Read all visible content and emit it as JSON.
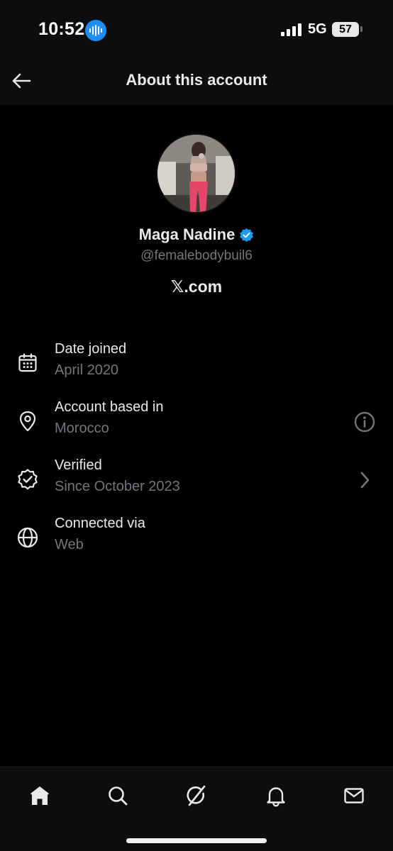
{
  "status_bar": {
    "time": "10:52",
    "network": "5G",
    "battery": "57"
  },
  "header": {
    "title": "About this account",
    "back_icon": "arrow-left-icon"
  },
  "profile": {
    "name": "Maga Nadine",
    "verified_icon": "verified-badge-icon",
    "handle": "@femalebodybuil6",
    "site": "𝕏.com"
  },
  "rows": [
    {
      "icon": "calendar-icon",
      "title": "Date joined",
      "subtitle": "April 2020"
    },
    {
      "icon": "location-pin-icon",
      "title": "Account based in",
      "subtitle": "Morocco",
      "action_icon": "info-icon"
    },
    {
      "icon": "verified-check-icon",
      "title": "Verified",
      "subtitle": "Since October 2023",
      "action_icon": "chevron-right-icon"
    },
    {
      "icon": "globe-icon",
      "title": "Connected via",
      "subtitle": "Web"
    }
  ],
  "bottom_nav": [
    {
      "icon": "home-icon"
    },
    {
      "icon": "search-icon"
    },
    {
      "icon": "grok-icon"
    },
    {
      "icon": "bell-icon"
    },
    {
      "icon": "mail-icon"
    }
  ],
  "colors": {
    "background": "#000000",
    "primary_text": "#e7e9ea",
    "secondary_text": "#71767b",
    "verified_blue": "#1d9bf0",
    "live_pill": "#1d8ef5"
  }
}
